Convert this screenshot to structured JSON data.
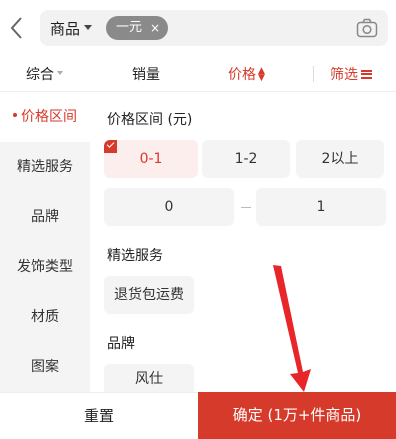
{
  "colors": {
    "accent": "#d63a2a",
    "chip_bg": "#8a8a8a",
    "panel_bg": "#f4f4f4"
  },
  "search": {
    "scope_label": "商品",
    "chip_label": "一元",
    "chip_close": "×",
    "back_icon": "chevron-left-icon",
    "camera_icon": "camera-icon"
  },
  "sort_tabs": {
    "comprehensive": "综合",
    "sales": "销量",
    "price": "价格",
    "filter": "筛选"
  },
  "categories": [
    {
      "label": "价格区间",
      "active": true
    },
    {
      "label": "精选服务",
      "active": false
    },
    {
      "label": "品牌",
      "active": false
    },
    {
      "label": "发饰类型",
      "active": false
    },
    {
      "label": "材质",
      "active": false
    },
    {
      "label": "图案",
      "active": false
    }
  ],
  "price_section": {
    "title": "价格区间 (元)",
    "options": [
      {
        "label": "0-1",
        "selected": true
      },
      {
        "label": "1-2",
        "selected": false
      },
      {
        "label": "2以上",
        "selected": false
      }
    ],
    "min_value": "0",
    "max_value": "1"
  },
  "service_section": {
    "title": "精选服务",
    "options": [
      "退货包运费"
    ]
  },
  "brand_section": {
    "title": "品牌",
    "options": [
      "风仕"
    ]
  },
  "bottom": {
    "reset": "重置",
    "confirm": "确定 (1万+件商品)"
  }
}
